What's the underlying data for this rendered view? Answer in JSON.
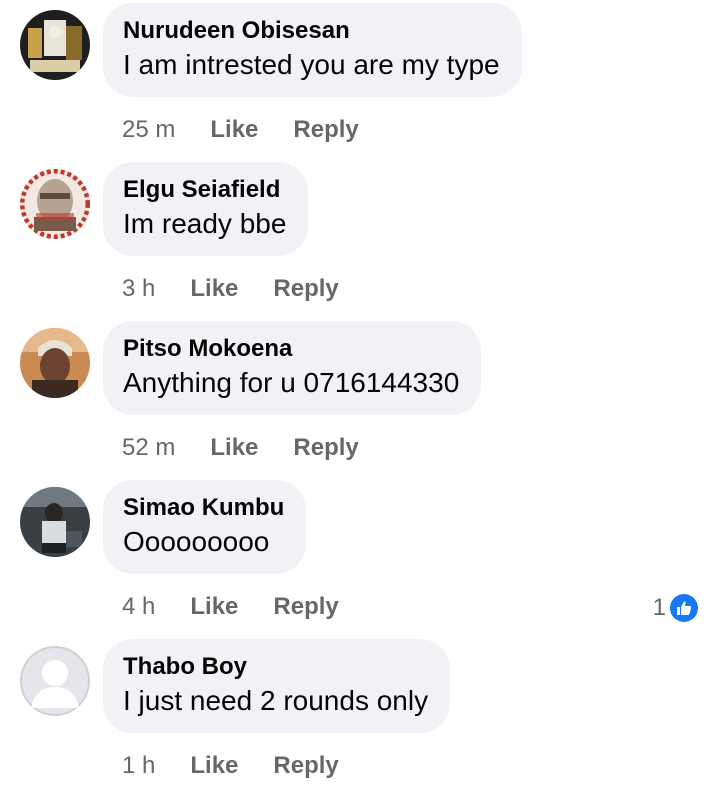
{
  "comments": [
    {
      "author": "Nurudeen Obisesan",
      "text": "I am intrested you are my type",
      "time": "25 m",
      "like_label": "Like",
      "reply_label": "Reply"
    },
    {
      "author": "Elgu Seiafield",
      "text": "Im ready bbe",
      "time": "3 h",
      "like_label": "Like",
      "reply_label": "Reply"
    },
    {
      "author": "Pitso Mokoena",
      "text": "Anything for u 0716144330",
      "time": "52 m",
      "like_label": "Like",
      "reply_label": "Reply"
    },
    {
      "author": "Simao Kumbu",
      "text": "Ooooooooo",
      "time": "4 h",
      "like_label": "Like",
      "reply_label": "Reply",
      "reaction_count": "1",
      "reaction_icon": "thumbs-up-icon"
    },
    {
      "author": "Thabo Boy",
      "text": "I just need 2 rounds only",
      "time": "1 h",
      "like_label": "Like",
      "reply_label": "Reply"
    }
  ],
  "colors": {
    "bubble": "#f0f2f5",
    "text": "#050505",
    "secondary": "#65676b",
    "like_blue": "#1877f2"
  }
}
